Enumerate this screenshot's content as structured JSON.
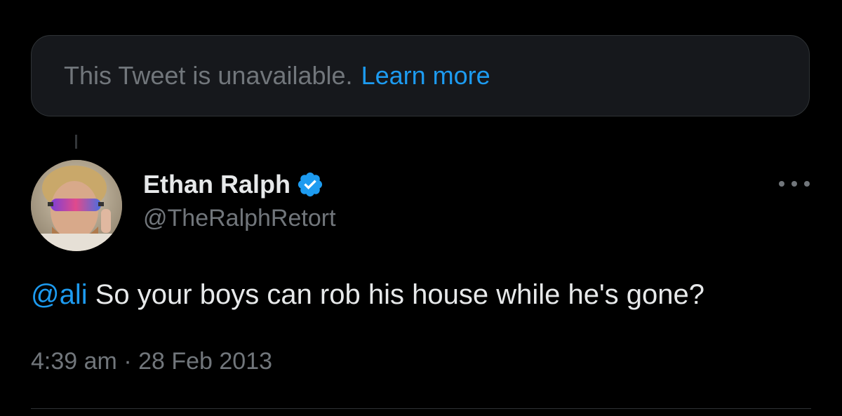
{
  "unavailable_notice": {
    "message": "This Tweet is unavailable.",
    "link_label": "Learn more"
  },
  "tweet": {
    "author": {
      "display_name": "Ethan Ralph",
      "handle": "@TheRalphRetort",
      "verified": true,
      "avatar_icon": "user-avatar"
    },
    "mention": "@ali",
    "body": "So your boys can rob his house while he's gone?",
    "time": "4:39 am",
    "separator": "·",
    "date": "28 Feb 2013",
    "more_icon": "ellipsis-icon"
  },
  "colors": {
    "background": "#000000",
    "accent": "#1d9bf0",
    "secondary_text": "#71767b",
    "primary_text": "#e7e9ea"
  }
}
